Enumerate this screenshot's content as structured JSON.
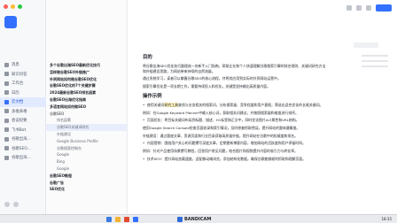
{
  "sidebar": {
    "items": [
      {
        "label": "消息"
      },
      {
        "label": "知识问答"
      },
      {
        "label": "工作台"
      },
      {
        "label": "日历"
      },
      {
        "label": "云文档"
      },
      {
        "label": "多维表格"
      },
      {
        "label": "会议纪要"
      },
      {
        "label": "飞书Bot"
      },
      {
        "label": "谷歌出海…"
      },
      {
        "label": "谷歌SEO…"
      },
      {
        "label": "谷歌出海…"
      }
    ]
  },
  "tree": {
    "items": [
      "多个谷歌出海SEO最新优化技巧",
      "怎样做谷歌SEO外链推广",
      "外贸网站如何做谷歌SEO优化",
      "谷歌SEO优化的7个关键步骤",
      "2024最新谷歌SEO排名因素",
      "谷歌SEO出海优化指南",
      "多语言网站如何做SEO",
      "谷歌SEO",
      "排名因素",
      "谷歌SEO关键词研究",
      "外链建设",
      "Google Business Profile",
      "谷歌搜索控制台",
      "Google",
      "Bing",
      "Google",
      "谷歌SEO教程",
      "谷歌广告",
      "SEO优化"
    ]
  },
  "doc": {
    "heading1": "目的",
    "para1": "将谷歌出海SEO优化技巧整理成一份新手入门指南，帮助企业和个人快速理解谷歌搜索引擎的排名规则、关键词研究方法和外链建设思路，为网站带来持续的自然流量。",
    "para2": "通过系统学习，读者可以掌握谷歌SEO的核心流程，并将其应用到实际的外贸网站运营中。",
    "para3": "搜索引擎优化是一项长期工作，需要持续投入和优化，关键是坚持输出高质量内容。",
    "heading2": "操作示例",
    "bullet1_pre": "使用关键词",
    "bullet1_hl": "研究工具",
    "bullet1_post": "查找与业务相关的搜索词，分析搜索量、竞争程度和用户意图，筛选出适合优化的长尾关键词。",
    "para4": "例如：在Google Keyword Planner中输入核心词，获取相关词建议，并按照搜索量和难度进行排序。",
    "bullet2": "页面优化：将目标关键词布局到标题、描述、H1标签和正文中，同时优化图片ALT属性和URL结构。",
    "para5": "使用Google Search Console检查页面收录和索引情况，及时修复抓取错误，提升网站的整体健康度。",
    "para6": "外链建设：通过客座文章、资源页面和行业目录获取高质量外链，提升网站在谷歌中的权威度和排名。",
    "bullet3": "内容营销：围绕用户关心的问题撰写深度文章，定期更新博客内容，增加网站的活跃度和用户停留时间。",
    "para7": "例如：针对产品使用场景撰写教程，回答用户常见问题，结合图片和视频提升内容的吸引力与转化率。",
    "bullet4": "技术SEO：提升网站加载速度，适配移动端浏览，添加结构化数据，确保谷歌能够顺利抓取和理解页面。"
  },
  "taskbar": {
    "bandicam": "BANDICAM",
    "time": "18:35"
  },
  "colors": {
    "accent": "#3370ff",
    "highlight": "#fff1b8"
  }
}
